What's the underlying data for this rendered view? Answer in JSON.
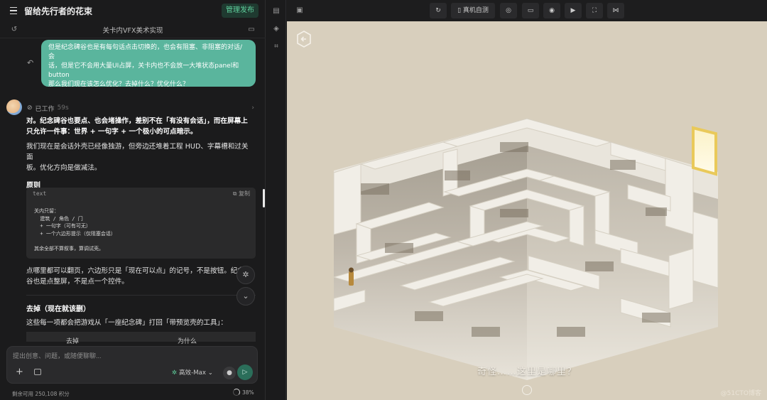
{
  "app": {
    "title": "留给先行者的花束",
    "publish_label": "管理发布",
    "subtitle": "关卡内VFX美术实现"
  },
  "chat": {
    "user_message": [
      "但是纪念碑谷也是有每句话点击切换的，也会有阻塞、非阻塞的对话/会",
      "话，但是它不会用大量UI占屏，关卡内也不会放一大堆状态panel和",
      "button",
      "那么我们现在该怎么优化？去掉什么？优化什么？"
    ],
    "work_status": "已工作",
    "work_duration": "59s",
    "reply": {
      "p1_a": "对。纪念碑谷也要点、也会堵操作，差别不在「有没有会话」，而在",
      "p1_b": "屏幕上",
      "p1_c": "只允许一件事：世界 + 一句字 + 一个极小的可点暗示。",
      "p2": "我们现在是会话外壳已经像独游，但旁边还堆着工程 HUD、字幕槽和过关面",
      "p2b": "板。优化方向是做减法。",
      "h_principles": "原则",
      "code_lang": "text",
      "copy_label": "复制",
      "code": [
        "关内只留：",
        "  建筑 / 角色 / 门",
        "  + 一句字（可有可无）",
        "  + 一个六边形提示（仅阻塞会话）",
        "",
        "其余全部不算叙事，算调试壳。"
      ],
      "p3a": "点哪里都可以翻页，六边形只是「现在可以点」的记号，不是按钮。纪念碑",
      "p3b": "谷也是点整屏，不是点一个控件。",
      "h_remove": "去掉（现在就该删）",
      "p4": "这些每一项都会把游戏从「一座纪念碑」打回「带预览壳的工具」：",
      "table_headers": [
        "去掉",
        "为什么"
      ]
    }
  },
  "composer": {
    "placeholder": "提出创意、问题，或随便聊聊...",
    "model": "高效-Max",
    "credit": "剩余可用 250,108 积分",
    "progress_pct": "38%"
  },
  "preview": {
    "toolbar": {
      "device_test_label": "真机自测"
    },
    "caption": "奇怪……这里是哪里？",
    "watermark": "@51CTO博客"
  },
  "colors": {
    "accent_green": "#5ab59d",
    "publish_green": "#5fcf9c",
    "game_bg": "#d8cfbd",
    "door_gold": "#e9c95a"
  },
  "icons": [
    "menu-icon",
    "history-icon",
    "chat-icon",
    "retry-icon",
    "chevron-right-icon",
    "copy-icon",
    "bug-icon",
    "chevron-down-icon",
    "plus-icon",
    "image-icon",
    "mic-icon",
    "send-icon",
    "refresh-icon",
    "phone-icon",
    "eye-off-icon",
    "screen-icon",
    "camera-icon",
    "video-icon",
    "fullscreen-icon",
    "share-icon",
    "back-hex-icon"
  ]
}
